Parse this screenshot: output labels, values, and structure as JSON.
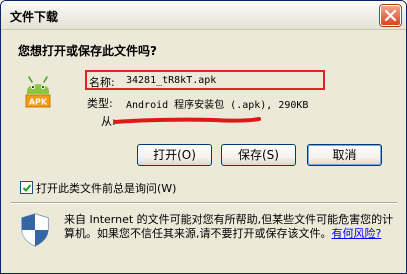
{
  "window": {
    "title": "文件下载"
  },
  "dialog": {
    "question": "您想打开或保存此文件吗?",
    "file": {
      "name_label": "名称:",
      "name_value": "34281_tR8kT.apk",
      "type_label": "类型:",
      "type_value": "Android  程序安装包 (.apk), 290KB",
      "from_label": "从:"
    },
    "buttons": {
      "open": "打开(O)",
      "save": "保存(S)",
      "cancel": "取消"
    },
    "checkbox": {
      "label": "打开此类文件前总是询问(W)",
      "checked": true
    },
    "warning": {
      "text": "来自 Internet 的文件可能对您有所帮助,但某些文件可能危害您的计算机。如果您不信任其来源,请不要打开或保存该文件。",
      "link": "有何风险?"
    },
    "icons": {
      "file_icon": "android-apk-icon",
      "warning_icon": "security-shield-icon",
      "close_icon": "close-icon"
    },
    "colors": {
      "highlight_border": "#E32222",
      "redaction": "#E01818",
      "link": "#0000FF"
    }
  }
}
